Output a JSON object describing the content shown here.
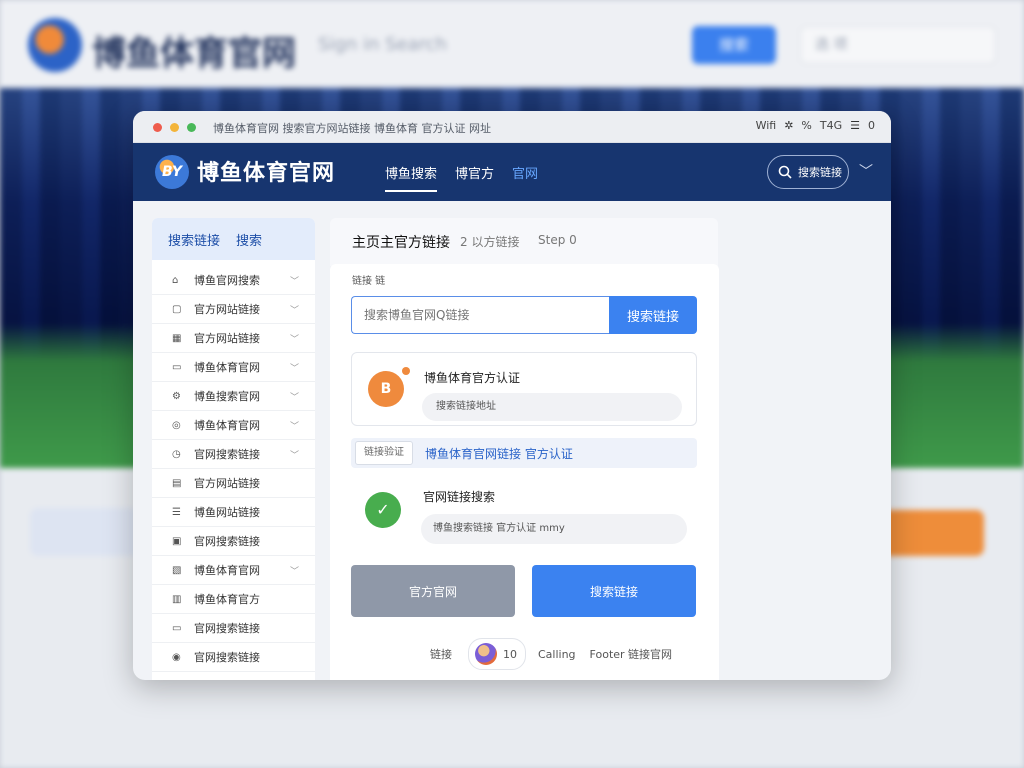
{
  "background": {
    "brand": "博鱼体育官网",
    "nav_text": "Sign in  Search",
    "button": "搜索",
    "select": "选 项"
  },
  "window": {
    "title": "博鱼体育官网 搜索官方网站链接 博鱼体育 官方认证 网址",
    "status": {
      "wifi": "Wifi",
      "percent": "%",
      "tone": "T4G",
      "count": "0"
    }
  },
  "navbar": {
    "logo_text": "BY",
    "brand": "博鱼体育官网",
    "links": [
      "博鱼搜索",
      "博官方",
      "官网"
    ],
    "search_label": "搜索链接"
  },
  "sidebar": {
    "header_items": [
      "搜索链接",
      "搜索"
    ],
    "items": [
      {
        "label": "博鱼官网搜索",
        "chevron": true
      },
      {
        "label": "官方网站链接",
        "chevron": true
      },
      {
        "label": "官方网站链接",
        "chevron": true
      },
      {
        "label": "博鱼体育官网",
        "chevron": true
      },
      {
        "label": "博鱼搜索官网",
        "chevron": true
      },
      {
        "label": "博鱼体育官网",
        "chevron": true
      },
      {
        "label": "官网搜索链接",
        "chevron": true
      },
      {
        "label": "官方网站链接",
        "chevron": false
      },
      {
        "label": "博鱼网站链接",
        "chevron": false
      },
      {
        "label": "官网搜索链接",
        "chevron": false
      },
      {
        "label": "博鱼体育官网",
        "chevron": true
      },
      {
        "label": "博鱼体育官方",
        "chevron": false
      },
      {
        "label": "官网搜索链接",
        "chevron": false
      },
      {
        "label": "官网搜索链接",
        "chevron": false
      }
    ]
  },
  "content": {
    "title": "主页主官方链接",
    "step1": "2 以方链接",
    "step2": "Step 0",
    "small_label": "链接 链",
    "search_placeholder": "搜索博鱼官网Q链接",
    "search_button": "搜索链接",
    "card1": {
      "icon_text": "B",
      "title": "博鱼体育官方认证",
      "pill": "搜索链接地址"
    },
    "verify": {
      "tag": "链接验证",
      "text": "博鱼体育官网链接 官方认证"
    },
    "card2": {
      "icon_text": "✓",
      "title": "官网链接搜索",
      "pill": "博鱼搜索链接  官方认证 mmy"
    },
    "btn_gray": "官方官网",
    "btn_blue": "搜索链接",
    "footer": {
      "label": "链接",
      "avatar_text": "10",
      "text1": "Calling",
      "text2": "Footer 链接官网"
    }
  }
}
